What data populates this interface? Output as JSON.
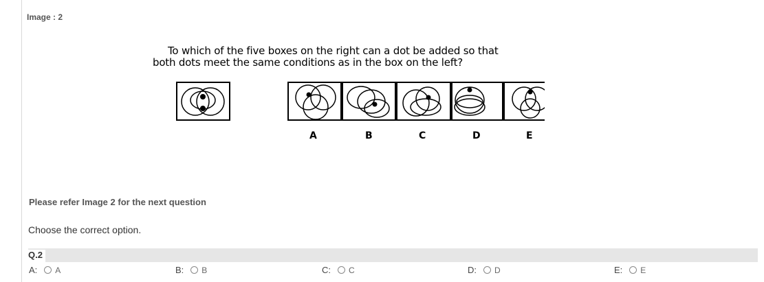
{
  "image_label": "Image : 2",
  "puzzle": {
    "line1": "To which of the five boxes on the right can a dot be added so that",
    "line2": "both dots meet the same conditions as in the box on the left?",
    "box_letters": [
      "A",
      "B",
      "C",
      "D",
      "E"
    ]
  },
  "refer_text": "Please refer Image 2 for the next question",
  "choose_text": "Choose the correct option.",
  "question_label": "Q.2",
  "options": [
    {
      "prefix": "A:",
      "text": "A"
    },
    {
      "prefix": "B:",
      "text": "B"
    },
    {
      "prefix": "C:",
      "text": "C"
    },
    {
      "prefix": "D:",
      "text": "D"
    },
    {
      "prefix": "E:",
      "text": "E"
    }
  ]
}
